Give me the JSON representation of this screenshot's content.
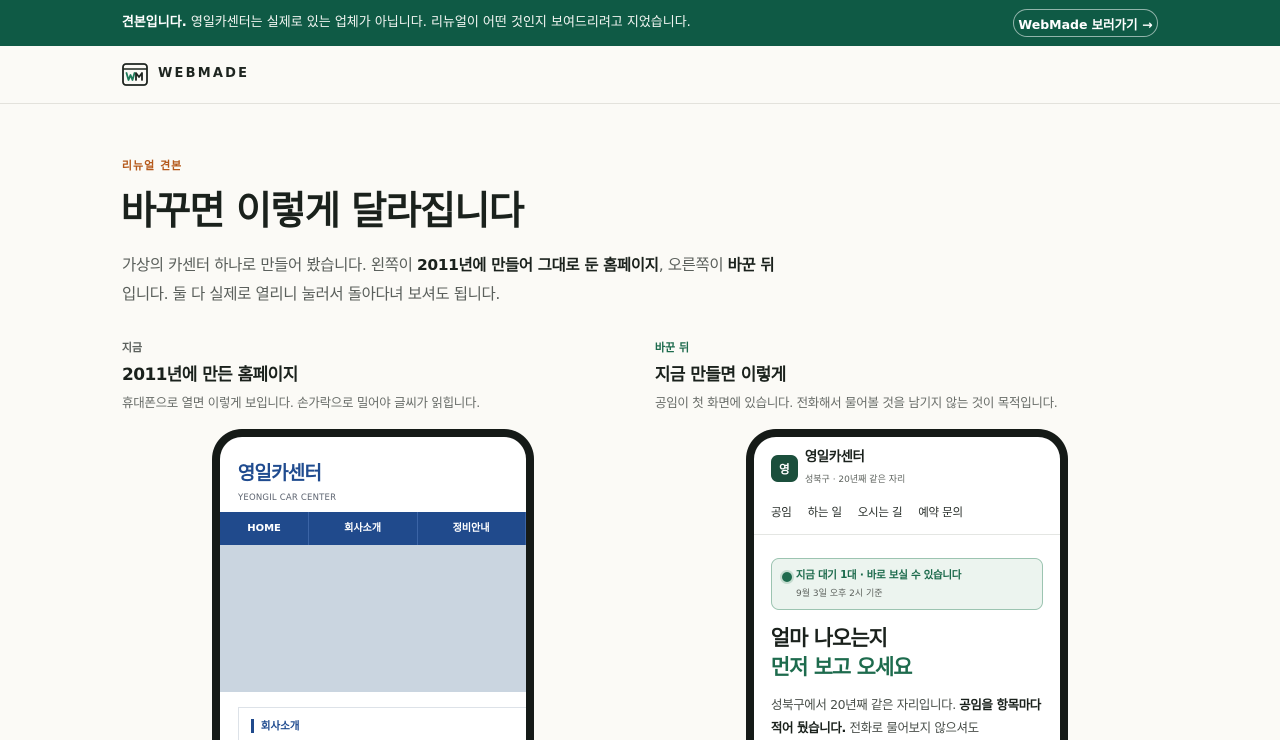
{
  "banner": {
    "bold": "견본입니다.",
    "text": " 영일카센터는 실제로 있는 업체가 아닙니다. 리뉴얼이 어떤 것인지 보여드리려고 지었습니다.",
    "button_label": "WebMade 보러가기 →"
  },
  "brand": {
    "name": "WEBMADE",
    "icon": "webmade-logo-icon"
  },
  "hero": {
    "eyebrow": "리뉴얼 견본",
    "title": "바꾸면 이렇게 달라집니다",
    "desc_1": "가상의 카센터 하나로 만들어 봤습니다. 왼쪽이 ",
    "desc_bold_1": "2011년에 만들어 그대로 둔 홈페이지",
    "desc_2": ", 오른쪽이 ",
    "desc_bold_2": "바꾼 뒤",
    "desc_3": "입니다. 둘 다 실제로 열리니 눌러서 돌아다녀 보셔도 됩니다."
  },
  "left_col": {
    "tag": "지금",
    "title": "2011년에 만든 홈페이지",
    "subtitle": "휴대폰으로 열면 이렇게 보입니다. 손가락으로 밀어야 글씨가 읽힙니다.",
    "site": {
      "brand": "영일카센터",
      "brand_sub": "YEONGIL CAR CENTER",
      "nav": [
        "HOME",
        "회사소개",
        "정비안내"
      ],
      "box_title": "회사소개"
    }
  },
  "right_col": {
    "tag": "바꾼 뒤",
    "title": "지금 만들면 이렇게",
    "subtitle": "공임이 첫 화면에 있습니다. 전화해서 물어볼 것을 남기지 않는 것이 목적입니다.",
    "site": {
      "avatar": "영",
      "name": "영일카센터",
      "meta": "성북구 · 20년째 같은 자리",
      "nav": [
        "공임",
        "하는 일",
        "오시는 길",
        "예약 문의"
      ],
      "status_title": "지금 대기 1대 · 바로 보실 수 있습니다",
      "status_time": "9월 3일 오후 2시 기준",
      "headline_1": "얼마 나오는지",
      "headline_2": "먼저 보고 오세요",
      "body_1": "성북구에서 20년째 같은 자리입니다. ",
      "body_bold": "공임을 항목마다 적어 뒀습니다.",
      "body_2": " 전화로 물어보지 않으셔도"
    }
  },
  "colors": {
    "banner_bg": "#0f5a45",
    "accent_orange": "#b5591b",
    "old_blue": "#204a8c",
    "new_green": "#1d6b4d"
  }
}
